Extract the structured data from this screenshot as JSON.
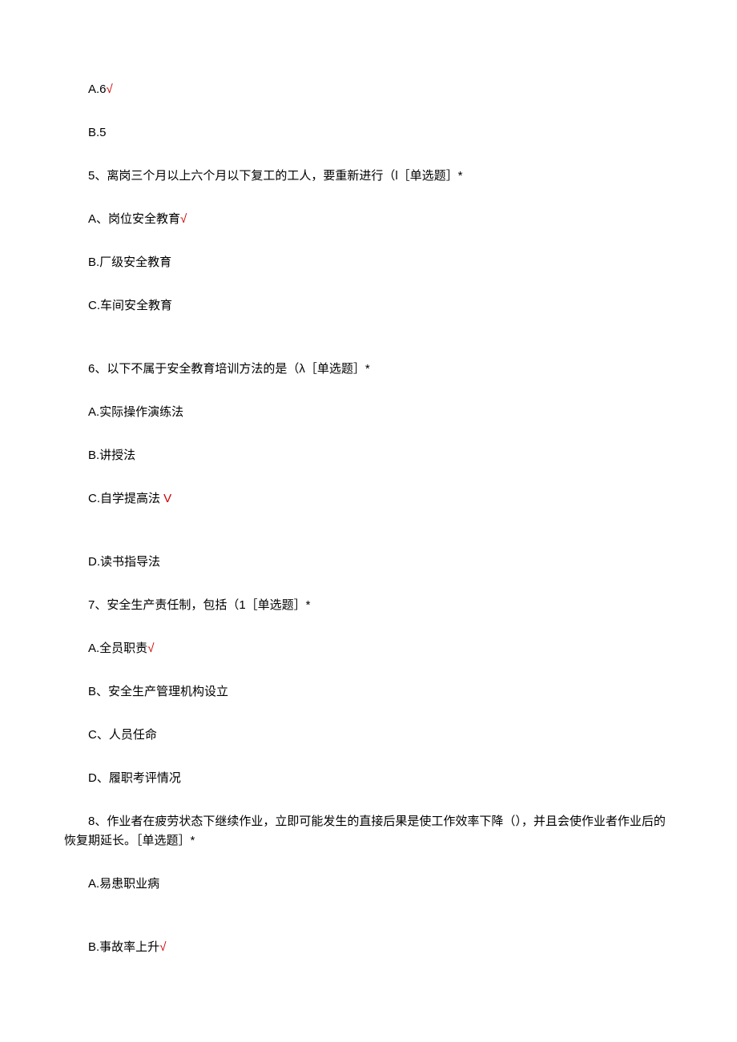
{
  "lines": [
    {
      "text": "A.6",
      "check": true,
      "gap": false
    },
    {
      "text": "B.5",
      "check": false,
      "gap": false
    },
    {
      "text": "5、离岗三个月以上六个月以下复工的工人，要重新进行（l［单选题］*",
      "check": false,
      "gap": false
    },
    {
      "text": "A、岗位安全教育",
      "check": true,
      "gap": false
    },
    {
      "text": "B.厂级安全教育",
      "check": false,
      "gap": false
    },
    {
      "text": "C.车间安全教育",
      "check": false,
      "gap": false
    },
    {
      "text": "6、以下不属于安全教育培训方法的是（λ［单选题］*",
      "check": false,
      "gap": true
    },
    {
      "text": "A.实际操作演练法",
      "check": false,
      "gap": false
    },
    {
      "text": "B.讲授法",
      "check": false,
      "gap": false
    },
    {
      "text": "C.自学提高法 ",
      "check": true,
      "checkChar": "V",
      "gap": false
    },
    {
      "text": "D.读书指导法",
      "check": false,
      "gap": true
    },
    {
      "text": "7、安全生产责任制，包括（1［单选题］*",
      "check": false,
      "gap": false,
      "italicFirst": "7"
    },
    {
      "text": "A.全员职责",
      "check": true,
      "gap": false
    },
    {
      "text": "B、安全生产管理机构设立",
      "check": false,
      "gap": false
    },
    {
      "text": "C、人员任命",
      "check": false,
      "gap": false
    },
    {
      "text": "D、履职考评情况",
      "check": false,
      "gap": false
    },
    {
      "text": "8、作业者在疲劳状态下继续作业，立即可能发生的直接后果是使工作效率下降（），并且会使作业者作业后的恢复期延长。［单选题］*",
      "check": false,
      "gap": false
    },
    {
      "text": "A.易患职业病",
      "check": false,
      "gap": false
    },
    {
      "text": "B.事故率上升",
      "check": true,
      "gap": true
    }
  ],
  "defaultCheck": "√"
}
